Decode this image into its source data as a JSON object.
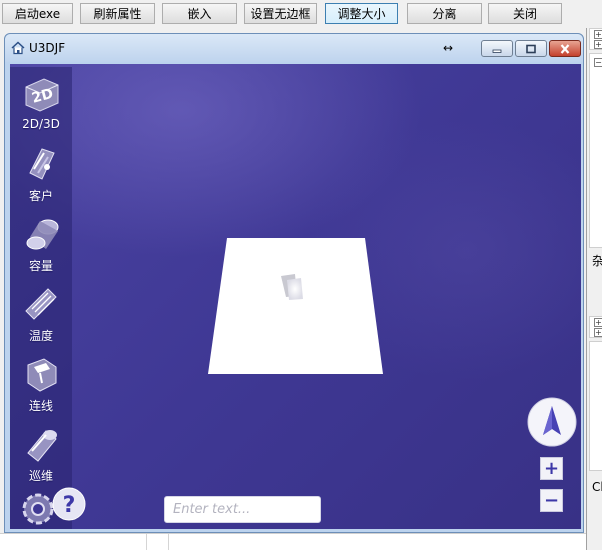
{
  "toolbar": {
    "buttons": [
      {
        "label": "启动exe",
        "active": false
      },
      {
        "label": "刷新属性",
        "active": false
      },
      {
        "label": "嵌入",
        "active": false
      },
      {
        "label": "设置无边框",
        "active": false
      },
      {
        "label": "调整大小",
        "active": true
      },
      {
        "label": "分离",
        "active": false
      },
      {
        "label": "关闭",
        "active": false
      }
    ]
  },
  "window": {
    "title": "U3DJF",
    "resize_glyph": "↔",
    "controls": [
      "minimize-icon",
      "maximize-icon",
      "close-icon"
    ]
  },
  "sidebar": {
    "items": [
      {
        "label": "2D/3D",
        "icon": "2d-3d-icon"
      },
      {
        "label": "客户",
        "icon": "customer-icon"
      },
      {
        "label": "容量",
        "icon": "capacity-icon"
      },
      {
        "label": "温度",
        "icon": "temperature-icon"
      },
      {
        "label": "连线",
        "icon": "connection-icon"
      },
      {
        "label": "巡维",
        "icon": "inspection-icon"
      }
    ],
    "bottom_icons": [
      "settings-gear-icon",
      "help-icon"
    ]
  },
  "viewport": {
    "input_placeholder": "Enter text...",
    "input_value": "",
    "zoom_in": "+",
    "zoom_out": "−",
    "navigation_icon": "compass-arrow-icon",
    "colors": {
      "background": "#3f3894",
      "floor": "#ffffff",
      "accent": "#3d38a8"
    }
  },
  "right_panel": {
    "label_1": "杂",
    "label_2": "Cl"
  }
}
